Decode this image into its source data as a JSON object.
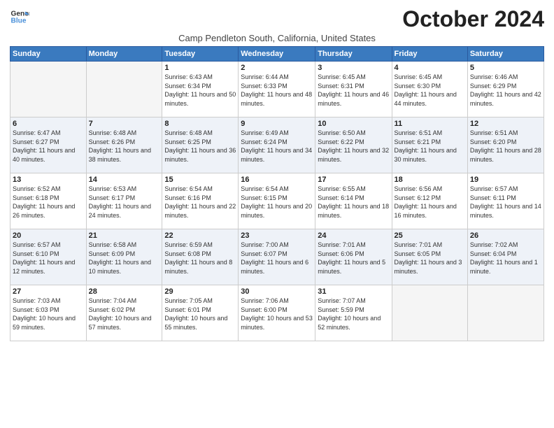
{
  "header": {
    "logo_line1": "General",
    "logo_line2": "Blue",
    "title": "October 2024",
    "subtitle": "Camp Pendleton South, California, United States"
  },
  "weekdays": [
    "Sunday",
    "Monday",
    "Tuesday",
    "Wednesday",
    "Thursday",
    "Friday",
    "Saturday"
  ],
  "weeks": [
    [
      {
        "num": "",
        "info": ""
      },
      {
        "num": "",
        "info": ""
      },
      {
        "num": "1",
        "info": "Sunrise: 6:43 AM\nSunset: 6:34 PM\nDaylight: 11 hours and 50 minutes."
      },
      {
        "num": "2",
        "info": "Sunrise: 6:44 AM\nSunset: 6:33 PM\nDaylight: 11 hours and 48 minutes."
      },
      {
        "num": "3",
        "info": "Sunrise: 6:45 AM\nSunset: 6:31 PM\nDaylight: 11 hours and 46 minutes."
      },
      {
        "num": "4",
        "info": "Sunrise: 6:45 AM\nSunset: 6:30 PM\nDaylight: 11 hours and 44 minutes."
      },
      {
        "num": "5",
        "info": "Sunrise: 6:46 AM\nSunset: 6:29 PM\nDaylight: 11 hours and 42 minutes."
      }
    ],
    [
      {
        "num": "6",
        "info": "Sunrise: 6:47 AM\nSunset: 6:27 PM\nDaylight: 11 hours and 40 minutes."
      },
      {
        "num": "7",
        "info": "Sunrise: 6:48 AM\nSunset: 6:26 PM\nDaylight: 11 hours and 38 minutes."
      },
      {
        "num": "8",
        "info": "Sunrise: 6:48 AM\nSunset: 6:25 PM\nDaylight: 11 hours and 36 minutes."
      },
      {
        "num": "9",
        "info": "Sunrise: 6:49 AM\nSunset: 6:24 PM\nDaylight: 11 hours and 34 minutes."
      },
      {
        "num": "10",
        "info": "Sunrise: 6:50 AM\nSunset: 6:22 PM\nDaylight: 11 hours and 32 minutes."
      },
      {
        "num": "11",
        "info": "Sunrise: 6:51 AM\nSunset: 6:21 PM\nDaylight: 11 hours and 30 minutes."
      },
      {
        "num": "12",
        "info": "Sunrise: 6:51 AM\nSunset: 6:20 PM\nDaylight: 11 hours and 28 minutes."
      }
    ],
    [
      {
        "num": "13",
        "info": "Sunrise: 6:52 AM\nSunset: 6:18 PM\nDaylight: 11 hours and 26 minutes."
      },
      {
        "num": "14",
        "info": "Sunrise: 6:53 AM\nSunset: 6:17 PM\nDaylight: 11 hours and 24 minutes."
      },
      {
        "num": "15",
        "info": "Sunrise: 6:54 AM\nSunset: 6:16 PM\nDaylight: 11 hours and 22 minutes."
      },
      {
        "num": "16",
        "info": "Sunrise: 6:54 AM\nSunset: 6:15 PM\nDaylight: 11 hours and 20 minutes."
      },
      {
        "num": "17",
        "info": "Sunrise: 6:55 AM\nSunset: 6:14 PM\nDaylight: 11 hours and 18 minutes."
      },
      {
        "num": "18",
        "info": "Sunrise: 6:56 AM\nSunset: 6:12 PM\nDaylight: 11 hours and 16 minutes."
      },
      {
        "num": "19",
        "info": "Sunrise: 6:57 AM\nSunset: 6:11 PM\nDaylight: 11 hours and 14 minutes."
      }
    ],
    [
      {
        "num": "20",
        "info": "Sunrise: 6:57 AM\nSunset: 6:10 PM\nDaylight: 11 hours and 12 minutes."
      },
      {
        "num": "21",
        "info": "Sunrise: 6:58 AM\nSunset: 6:09 PM\nDaylight: 11 hours and 10 minutes."
      },
      {
        "num": "22",
        "info": "Sunrise: 6:59 AM\nSunset: 6:08 PM\nDaylight: 11 hours and 8 minutes."
      },
      {
        "num": "23",
        "info": "Sunrise: 7:00 AM\nSunset: 6:07 PM\nDaylight: 11 hours and 6 minutes."
      },
      {
        "num": "24",
        "info": "Sunrise: 7:01 AM\nSunset: 6:06 PM\nDaylight: 11 hours and 5 minutes."
      },
      {
        "num": "25",
        "info": "Sunrise: 7:01 AM\nSunset: 6:05 PM\nDaylight: 11 hours and 3 minutes."
      },
      {
        "num": "26",
        "info": "Sunrise: 7:02 AM\nSunset: 6:04 PM\nDaylight: 11 hours and 1 minute."
      }
    ],
    [
      {
        "num": "27",
        "info": "Sunrise: 7:03 AM\nSunset: 6:03 PM\nDaylight: 10 hours and 59 minutes."
      },
      {
        "num": "28",
        "info": "Sunrise: 7:04 AM\nSunset: 6:02 PM\nDaylight: 10 hours and 57 minutes."
      },
      {
        "num": "29",
        "info": "Sunrise: 7:05 AM\nSunset: 6:01 PM\nDaylight: 10 hours and 55 minutes."
      },
      {
        "num": "30",
        "info": "Sunrise: 7:06 AM\nSunset: 6:00 PM\nDaylight: 10 hours and 53 minutes."
      },
      {
        "num": "31",
        "info": "Sunrise: 7:07 AM\nSunset: 5:59 PM\nDaylight: 10 hours and 52 minutes."
      },
      {
        "num": "",
        "info": ""
      },
      {
        "num": "",
        "info": ""
      }
    ]
  ],
  "colors": {
    "header_bg": "#3a7abf",
    "row_alt": "#eef2f8",
    "accent_blue": "#4a90d9"
  }
}
